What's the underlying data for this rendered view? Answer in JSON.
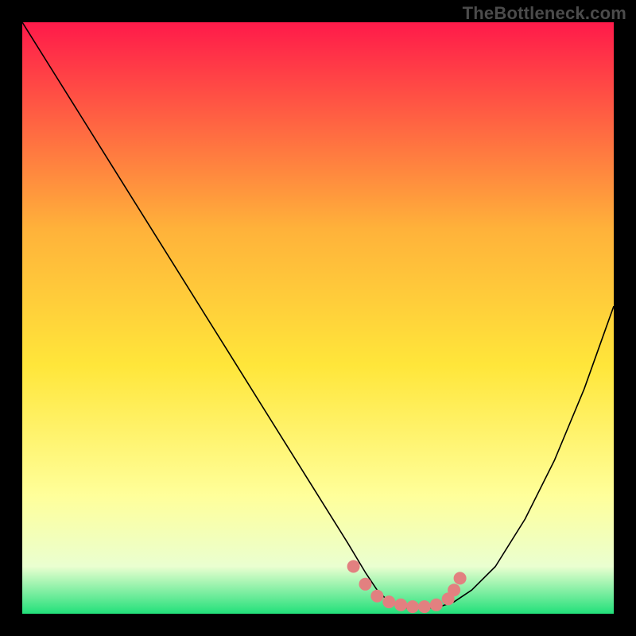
{
  "watermark": "TheBottleneck.com",
  "colors": {
    "gradient_top": "#ff1a4a",
    "gradient_mid_upper": "#ffb23a",
    "gradient_mid": "#ffe63a",
    "gradient_lower": "#ffff9a",
    "gradient_pale": "#eaffd0",
    "gradient_bottom": "#22e07a",
    "curve": "#000000",
    "marker": "#e28080",
    "frame": "#000000"
  },
  "chart_data": {
    "type": "line",
    "title": "",
    "xlabel": "",
    "ylabel": "",
    "xlim": [
      0,
      100
    ],
    "ylim": [
      0,
      100
    ],
    "series": [
      {
        "name": "bottleneck-curve",
        "x": [
          0,
          5,
          10,
          15,
          20,
          25,
          30,
          35,
          40,
          45,
          50,
          55,
          58,
          60,
          62,
          65,
          68,
          70,
          73,
          76,
          80,
          85,
          90,
          95,
          100
        ],
        "y": [
          100,
          92,
          84,
          76,
          68,
          60,
          52,
          44,
          36,
          28,
          20,
          12,
          7,
          4,
          2,
          1,
          1,
          1,
          2,
          4,
          8,
          16,
          26,
          38,
          52
        ]
      }
    ],
    "markers": {
      "name": "highlight-points",
      "x": [
        56,
        58,
        60,
        62,
        64,
        66,
        68,
        70,
        72,
        73,
        74
      ],
      "y": [
        8,
        5,
        3,
        2,
        1.5,
        1.2,
        1.2,
        1.5,
        2.5,
        4,
        6
      ]
    }
  }
}
